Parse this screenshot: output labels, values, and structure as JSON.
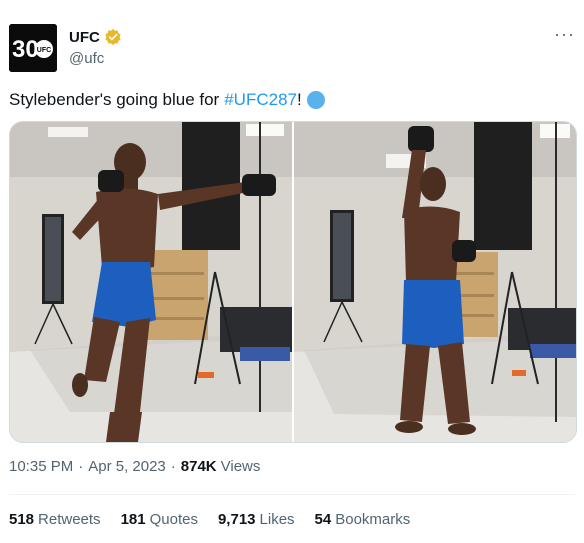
{
  "account": {
    "avatar_text": "30",
    "avatar_badge": "UFC",
    "name": "UFC",
    "handle": "@ufc",
    "verified_icon": "verified-badge-gold"
  },
  "menu": {
    "more_label": "···"
  },
  "tweet": {
    "text_prefix": "Stylebender's going blue for",
    "hashtag": "#UFC287",
    "text_suffix": "!",
    "emoji": "blue-circle"
  },
  "media": {
    "photos": [
      {
        "alt": "Fighter in blue shorts throwing a punch in a studio"
      },
      {
        "alt": "Fighter in blue shorts posing with fist raised in a studio"
      }
    ]
  },
  "meta": {
    "time": "10:35 PM",
    "date": "Apr 5, 2023",
    "separator": "·",
    "views_count": "874K",
    "views_label": "Views"
  },
  "stats": [
    {
      "num": "518",
      "label": "Retweets"
    },
    {
      "num": "181",
      "label": "Quotes"
    },
    {
      "num": "9,713",
      "label": "Likes"
    },
    {
      "num": "54",
      "label": "Bookmarks"
    }
  ],
  "colors": {
    "link": "#1d9bf0",
    "secondary_text": "#536471",
    "shorts_blue": "#1c5fbf",
    "verified_gold": "#e8b829"
  }
}
